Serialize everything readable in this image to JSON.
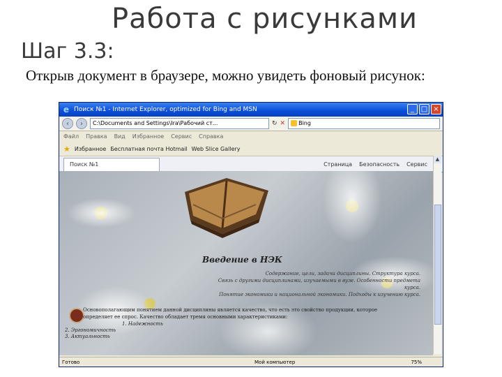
{
  "slide": {
    "title": "Работа с рисунками",
    "step": "Шаг 3.3:",
    "paragraph": "Открыв документ в браузере, можно увидеть фоновый рисунок:"
  },
  "browser": {
    "title_bar": "Поиск №1 - Internet Explorer, optimized for Bing and MSN",
    "address": "C:\\Documents and Settings\\Ira\\Рабочий ст...",
    "search_placeholder": "Bing",
    "menu": [
      "Файл",
      "Правка",
      "Вид",
      "Избранное",
      "Сервис",
      "Справка"
    ],
    "favorites_label": "Избранное",
    "fav_links": [
      "Бесплатная почта Hotmail",
      "Web Slice Gallery"
    ],
    "tab_label": "Поиск №1",
    "commands": [
      "Страница",
      "Безопасность",
      "Сервис"
    ],
    "status_left": "Готово",
    "status_zone": "Мой компьютер",
    "status_zoom": "75%"
  },
  "page": {
    "heading": "Введение в НЭК",
    "intro_lines": [
      "Содержание, цели, задачи дисциплины. Структура курса.",
      "Связь с другими дисциплинами, изучаемыми в вузе. Особенности предмета курса.",
      "Понятие экономики и национальной экономики. Подходы к изучению курса."
    ],
    "definition": "Основополагающим понятием данной дисциплины является качество, что есть это свойство продукции, которое определяет ее спрос. Качество обладает тремя основными характеристиками:",
    "list": [
      "1. Надежность",
      "2. Эргономичность",
      "3. Актуальность"
    ]
  },
  "icons": {
    "browser": "ie-logo-icon",
    "back": "back-arrow-icon",
    "forward": "forward-arrow-icon",
    "refresh": "refresh-icon",
    "stop": "stop-icon",
    "favorites": "star-icon"
  }
}
